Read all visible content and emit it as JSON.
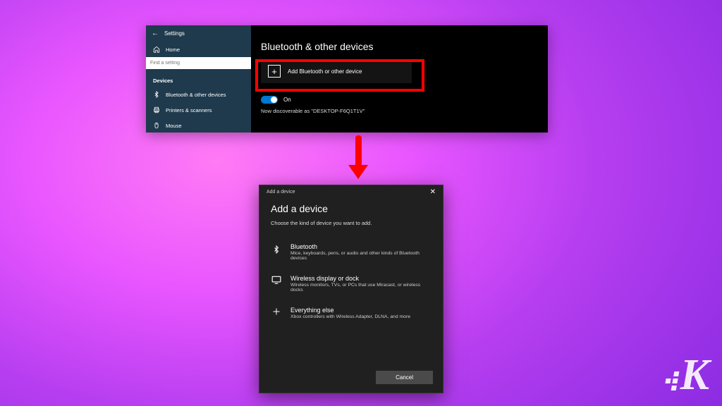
{
  "settings": {
    "app_title": "Settings",
    "home_label": "Home",
    "search_placeholder": "Find a setting",
    "devices_category": "Devices",
    "sidebar_items": [
      {
        "label": "Bluetooth & other devices"
      },
      {
        "label": "Printers & scanners"
      },
      {
        "label": "Mouse"
      }
    ],
    "page_title": "Bluetooth & other devices",
    "add_button_label": "Add Bluetooth or other device",
    "toggle_state": "On",
    "discoverable_text": "Now discoverable as \"DESKTOP-F6Q1T1V\""
  },
  "dialog": {
    "titlebar": "Add a device",
    "heading": "Add a device",
    "subheading": "Choose the kind of device you want to add.",
    "options": [
      {
        "title": "Bluetooth",
        "desc": "Mice, keyboards, pens, or audio and other kinds of Bluetooth devices"
      },
      {
        "title": "Wireless display or dock",
        "desc": "Wireless monitors, TVs, or PCs that use Miracast, or wireless docks"
      },
      {
        "title": "Everything else",
        "desc": "Xbox controllers with Wireless Adapter, DLNA, and more"
      }
    ],
    "cancel_label": "Cancel"
  },
  "logo_letter": "K"
}
